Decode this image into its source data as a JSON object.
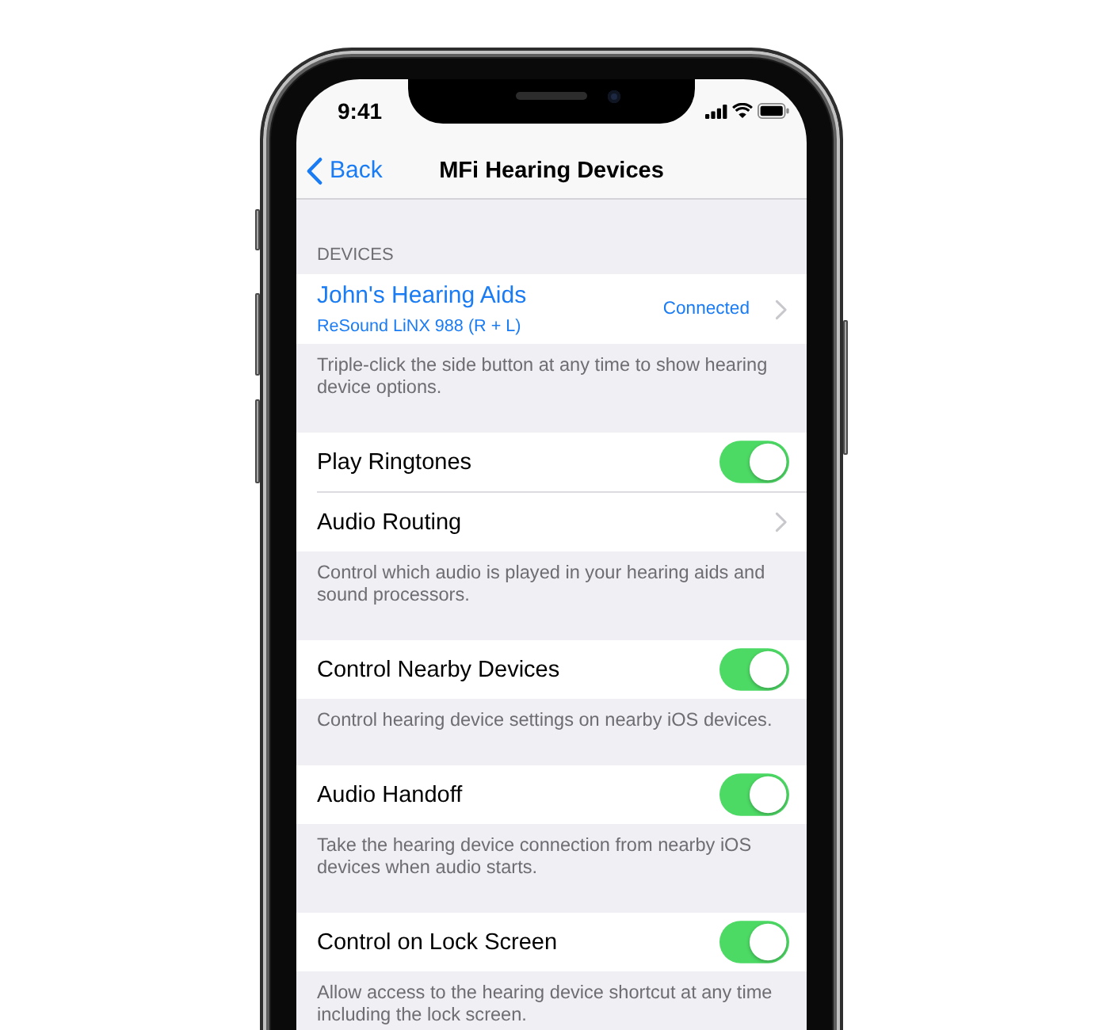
{
  "status_bar": {
    "time": "9:41"
  },
  "nav_bar": {
    "back_label": "Back",
    "title": "MFi Hearing Devices"
  },
  "sections": [
    {
      "header": "DEVICES",
      "rows": [
        {
          "kind": "device",
          "name": "John's Hearing Aids",
          "model": "ReSound LiNX 988 (R + L)",
          "status": "Connected"
        }
      ],
      "footer": "Triple-click the side button at any time to show hearing device options."
    },
    {
      "rows": [
        {
          "kind": "toggle",
          "label": "Play Ringtones",
          "on": true
        },
        {
          "kind": "link",
          "label": "Audio Routing"
        }
      ],
      "footer": "Control which audio is played in your hearing aids and sound processors."
    },
    {
      "rows": [
        {
          "kind": "toggle",
          "label": "Control Nearby Devices",
          "on": true
        }
      ],
      "footer": "Control hearing device settings on nearby iOS devices."
    },
    {
      "rows": [
        {
          "kind": "toggle",
          "label": "Audio Handoff",
          "on": true
        }
      ],
      "footer": "Take the hearing device connection from nearby iOS devices when audio starts."
    },
    {
      "rows": [
        {
          "kind": "toggle",
          "label": "Control on Lock Screen",
          "on": true
        }
      ],
      "footer": "Allow access to the hearing device shortcut at any time including the lock screen."
    }
  ]
}
